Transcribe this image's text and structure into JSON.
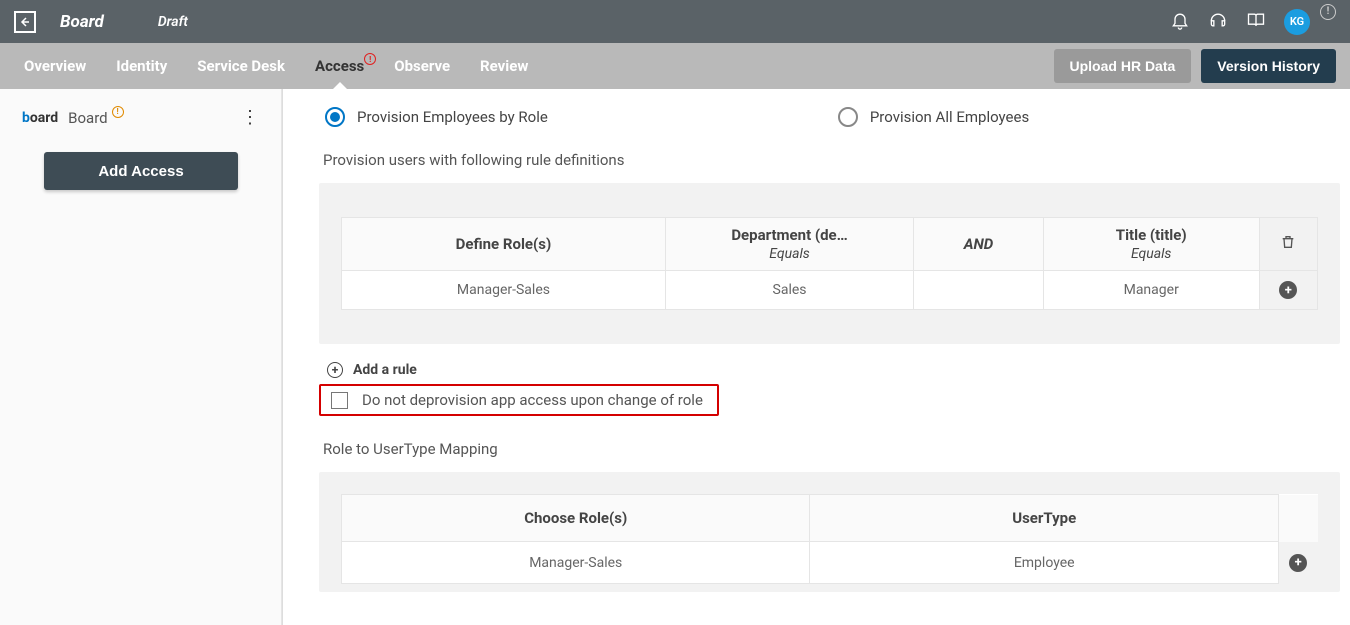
{
  "topbar": {
    "title": "Board",
    "status": "Draft",
    "avatar": "KG"
  },
  "subnav": {
    "tabs": [
      "Overview",
      "Identity",
      "Service Desk",
      "Access",
      "Observe",
      "Review"
    ],
    "active_index": 3,
    "upload_label": "Upload HR Data",
    "history_label": "Version History"
  },
  "sidebar": {
    "app_name": "Board",
    "add_access_label": "Add Access"
  },
  "main": {
    "radios": {
      "by_role": "Provision Employees by Role",
      "all": "Provision All Employees",
      "selected": "by_role"
    },
    "rules_section_label": "Provision users with following rule definitions",
    "rules_table": {
      "col_role": "Define Role(s)",
      "col_dept": "Department (de…",
      "col_dept_op": "Equals",
      "col_and": "AND",
      "col_title": "Title (title)",
      "col_title_op": "Equals",
      "row": {
        "role": "Manager-Sales",
        "dept": "Sales",
        "title": "Manager"
      }
    },
    "add_rule_label": "Add a rule",
    "deprovision_checkbox_label": "Do not deprovision app access upon change of role",
    "mapping_section_label": "Role to UserType Mapping",
    "mapping_table": {
      "col_role": "Choose Role(s)",
      "col_usertype": "UserType",
      "row": {
        "role": "Manager-Sales",
        "usertype": "Employee"
      }
    }
  }
}
